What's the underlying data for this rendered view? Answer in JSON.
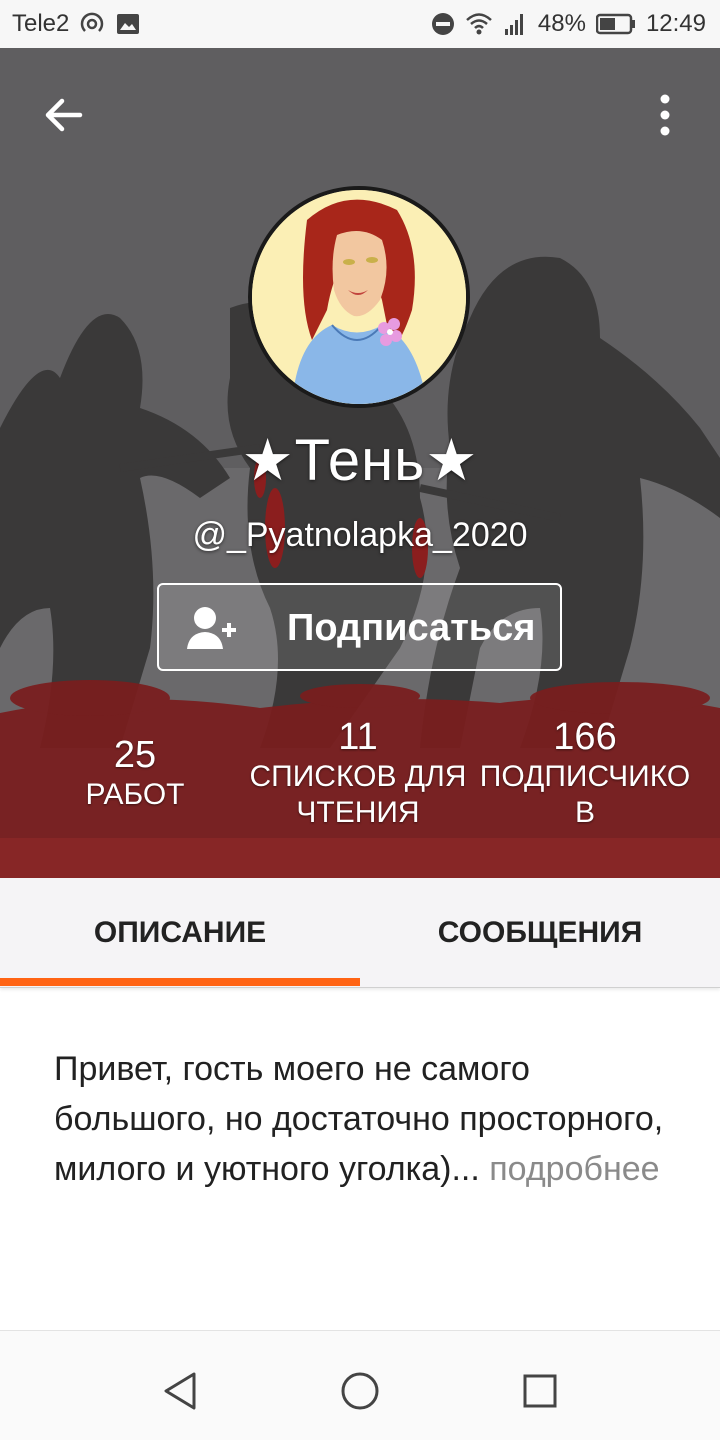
{
  "status_bar": {
    "carrier": "Tele2",
    "battery": "48%",
    "time": "12:49",
    "icons": [
      "radio-icon",
      "image-icon",
      "dnd-icon",
      "wifi-icon",
      "signal-icon",
      "battery-icon"
    ]
  },
  "header": {
    "name": "★Тень★",
    "handle": "@_Pyatnolapka_2020",
    "follow_label": "Подписаться",
    "icons": [
      "back-arrow-icon",
      "more-vert-icon",
      "add-user-icon"
    ]
  },
  "stats": [
    {
      "value": "25",
      "label_line1": "РАБОТ",
      "label_line2": ""
    },
    {
      "value": "11",
      "label_line1": "СПИСКОВ ДЛЯ",
      "label_line2": "ЧТЕНИЯ"
    },
    {
      "value": "166",
      "label_line1": "ПОДПИСЧИКО",
      "label_line2": "В"
    }
  ],
  "tabs": [
    {
      "label": "ОПИСАНИЕ",
      "active": true
    },
    {
      "label": "СООБЩЕНИЯ",
      "active": false
    }
  ],
  "description": {
    "text": "Привет, гость моего не самого большого, но достаточно просторного, милого и уютного уголка)",
    "ellipsis": "...",
    "more": " подробнее"
  },
  "navbar": {
    "icons": [
      "nav-back-icon",
      "nav-home-icon",
      "nav-recents-icon"
    ]
  },
  "colors": {
    "accent": "#ff6414",
    "header_bg": "#5c5b5d",
    "blood": "#7a1d1d",
    "tab_bg": "#f5f4f6"
  }
}
